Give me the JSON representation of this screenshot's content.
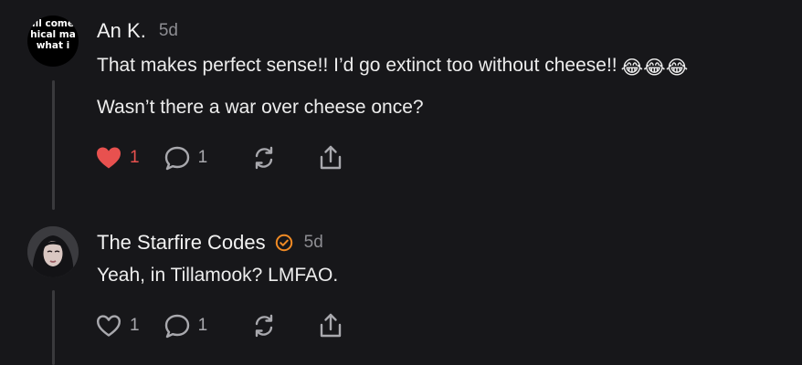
{
  "comments": [
    {
      "avatar_text": [
        "ıll come",
        "hical ma",
        "what i"
      ],
      "author": "An K.",
      "timestamp": "5d",
      "paragraphs": [
        "That makes perfect sense!! I’d go extinct too without cheese!!",
        "Wasn’t there a war over cheese once?"
      ],
      "emoji": "😂😂😂",
      "likes": "1",
      "liked": true,
      "replies": "1",
      "like_color": "#e8514f"
    },
    {
      "author": "The Starfire Codes",
      "verified_icon": "verified-badge-icon",
      "verified_color": "#f08a24",
      "timestamp": "5d",
      "paragraphs": [
        "Yeah, in Tillamook? LMFAO."
      ],
      "likes": "1",
      "liked": false,
      "replies": "1"
    }
  ],
  "icons": [
    "heart-icon",
    "comment-icon",
    "repost-icon",
    "share-icon"
  ]
}
